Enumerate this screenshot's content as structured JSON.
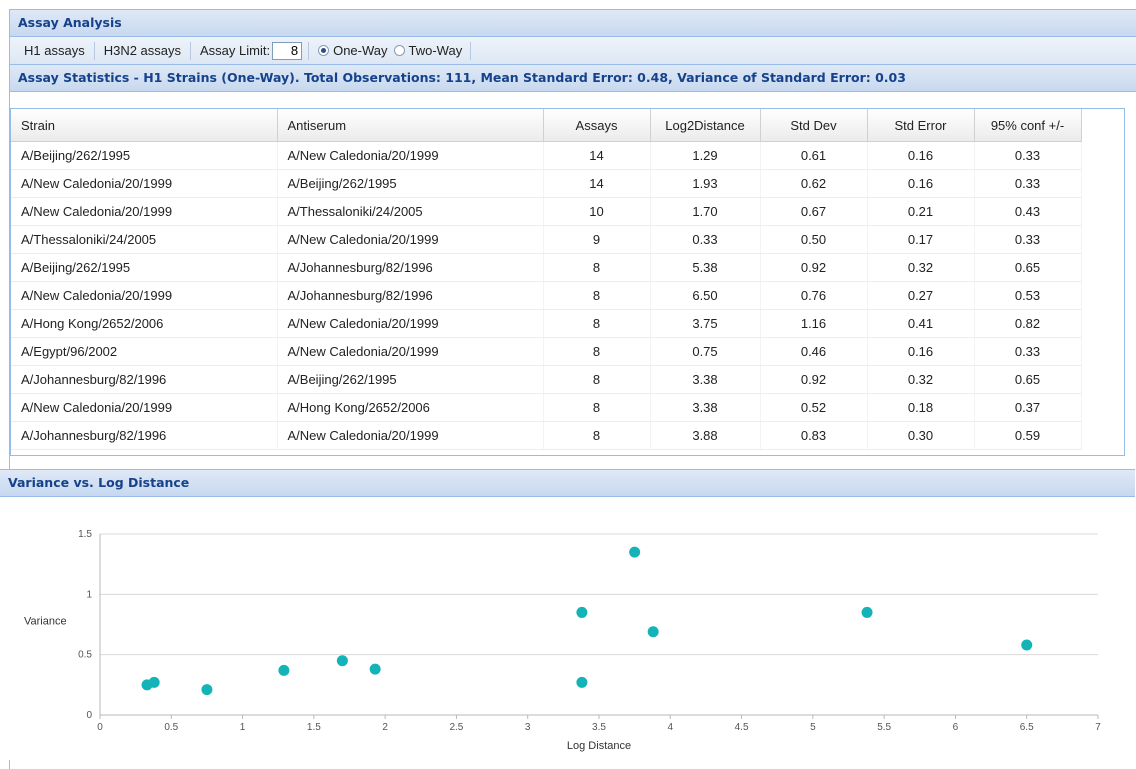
{
  "header": {
    "title": "Assay Analysis"
  },
  "toolbar": {
    "h1_label": "H1 assays",
    "h3n2_label": "H3N2 assays",
    "limit_label": "Assay Limit:",
    "limit_value": "8",
    "one_way_label": "One-Way",
    "two_way_label": "Two-Way",
    "one_way_selected": true
  },
  "stats": {
    "title": "Assay Statistics - H1 Strains (One-Way). Total Observations: 111, Mean Standard Error: 0.48, Variance of Standard Error: 0.03"
  },
  "table": {
    "columns": [
      "Strain",
      "Antiserum",
      "Assays",
      "Log2Distance",
      "Std Dev",
      "Std Error",
      "95% conf +/-"
    ],
    "rows": [
      [
        "A/Beijing/262/1995",
        "A/New Caledonia/20/1999",
        "14",
        "1.29",
        "0.61",
        "0.16",
        "0.33"
      ],
      [
        "A/New Caledonia/20/1999",
        "A/Beijing/262/1995",
        "14",
        "1.93",
        "0.62",
        "0.16",
        "0.33"
      ],
      [
        "A/New Caledonia/20/1999",
        "A/Thessaloniki/24/2005",
        "10",
        "1.70",
        "0.67",
        "0.21",
        "0.43"
      ],
      [
        "A/Thessaloniki/24/2005",
        "A/New Caledonia/20/1999",
        "9",
        "0.33",
        "0.50",
        "0.17",
        "0.33"
      ],
      [
        "A/Beijing/262/1995",
        "A/Johannesburg/82/1996",
        "8",
        "5.38",
        "0.92",
        "0.32",
        "0.65"
      ],
      [
        "A/New Caledonia/20/1999",
        "A/Johannesburg/82/1996",
        "8",
        "6.50",
        "0.76",
        "0.27",
        "0.53"
      ],
      [
        "A/Hong Kong/2652/2006",
        "A/New Caledonia/20/1999",
        "8",
        "3.75",
        "1.16",
        "0.41",
        "0.82"
      ],
      [
        "A/Egypt/96/2002",
        "A/New Caledonia/20/1999",
        "8",
        "0.75",
        "0.46",
        "0.16",
        "0.33"
      ],
      [
        "A/Johannesburg/82/1996",
        "A/Beijing/262/1995",
        "8",
        "3.38",
        "0.92",
        "0.32",
        "0.65"
      ],
      [
        "A/New Caledonia/20/1999",
        "A/Hong Kong/2652/2006",
        "8",
        "3.38",
        "0.52",
        "0.18",
        "0.37"
      ],
      [
        "A/Johannesburg/82/1996",
        "A/New Caledonia/20/1999",
        "8",
        "3.88",
        "0.83",
        "0.30",
        "0.59"
      ]
    ]
  },
  "chart_panel": {
    "title": "Variance vs. Log Distance"
  },
  "colors": {
    "point": "#14b3b8",
    "header_text": "#15428b"
  },
  "chart_data": {
    "type": "scatter",
    "title": "",
    "xlabel": "Log Distance",
    "ylabel": "Variance",
    "xlim": [
      0,
      7
    ],
    "ylim": [
      0,
      1.5
    ],
    "xticks": [
      "0",
      "0.5",
      "1",
      "1.5",
      "2",
      "2.5",
      "3",
      "3.5",
      "4",
      "4.5",
      "5",
      "5.5",
      "6",
      "6.5",
      "7"
    ],
    "yticks": [
      "0",
      "0.5",
      "1",
      "1.5"
    ],
    "grid": "horizontal",
    "points": [
      {
        "x": 0.33,
        "y": 0.25
      },
      {
        "x": 0.38,
        "y": 0.27
      },
      {
        "x": 0.75,
        "y": 0.21
      },
      {
        "x": 1.29,
        "y": 0.37
      },
      {
        "x": 1.7,
        "y": 0.45
      },
      {
        "x": 1.93,
        "y": 0.38
      },
      {
        "x": 3.38,
        "y": 0.85
      },
      {
        "x": 3.38,
        "y": 0.27
      },
      {
        "x": 3.75,
        "y": 1.35
      },
      {
        "x": 3.88,
        "y": 0.69
      },
      {
        "x": 5.38,
        "y": 0.85
      },
      {
        "x": 6.5,
        "y": 0.58
      }
    ]
  }
}
